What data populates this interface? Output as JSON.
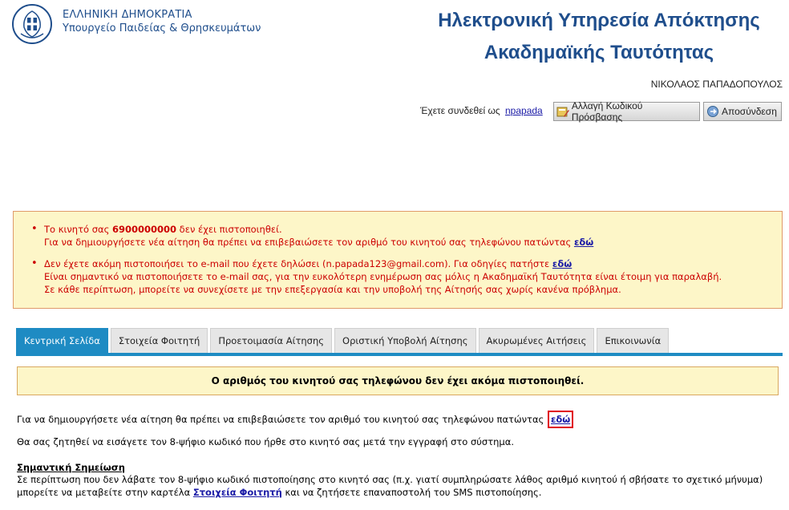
{
  "header": {
    "gov_line1": "ΕΛΛΗΝΙΚΗ ΔΗΜΟΚΡΑΤΙΑ",
    "gov_line2": "Υπουργείο Παιδείας & Θρησκευμάτων",
    "title_line1": "Ηλεκτρονική Υπηρεσία Απόκτησης",
    "title_line2": "Ακαδημαϊκής Ταυτότητας",
    "user_name": "ΝΙΚΟΛΑΟΣ ΠΑΠΑΔΟΠΟΥΛΟΣ",
    "logged_in_text": "Έχετε συνδεθεί ως",
    "username": "npapada",
    "change_password_label": "Αλλαγή Κωδικού Πρόσβασης",
    "logout_label": "Αποσύνδεση"
  },
  "warnings": {
    "w1_pre": "Το κινητό σας ",
    "w1_number": "6900000000",
    "w1_post": " δεν έχει πιστοποιηθεί.",
    "w1_line2": "Για να δημιουργήσετε νέα αίτηση θα πρέπει να επιβεβαιώσετε τον αριθμό του κινητού σας τηλεφώνου πατώντας",
    "w1_link": "εδώ",
    "w2_line1": "Δεν έχετε ακόμη πιστοποιήσει το e-mail που έχετε δηλώσει (n.papada123@gmail.com). Για οδηγίες πατήστε",
    "w2_link": "εδώ",
    "w2_line2": "Είναι σημαντικό να πιστοποιήσετε το e-mail σας, για την ευκολότερη ενημέρωση σας μόλις η Ακαδημαϊκή Ταυτότητα είναι έτοιμη για παραλαβή.",
    "w2_line3": "Σε κάθε περίπτωση, μπορείτε να συνεχίσετε με την επεξεργασία και την υποβολή της Αίτησής σας χωρίς κανένα πρόβλημα."
  },
  "tabs": [
    "Κεντρική Σελίδα",
    "Στοιχεία Φοιτητή",
    "Προετοιμασία Αίτησης",
    "Οριστική Υποβολή Αίτησης",
    "Ακυρωμένες Αιτήσεις",
    "Επικοινωνία"
  ],
  "main": {
    "notice": "Ο αριθμός του κινητού σας τηλεφώνου δεν έχει ακόμα πιστοποιηθεί.",
    "p1_text": "Για να δημιουργήσετε νέα αίτηση θα πρέπει να επιβεβαιώσετε τον αριθμό του κινητού σας τηλεφώνου πατώντας",
    "p1_link": "εδώ",
    "p2_text": "Θα σας ζητηθεί να εισάγετε τον 8-ψήφιο κωδικό που ήρθε στο κινητό σας μετά την εγγραφή στο σύστημα.",
    "note_title": "Σημαντική Σημείωση",
    "p3_pre": "Σε περίπτωση που δεν λάβατε τον 8-ψήφιο κωδικό πιστοποίησης στο κινητό σας (π.χ. γιατί συμπληρώσατε λάθος αριθμό κινητού ή σβήσατε το σχετικό μήνυμα) μπορείτε να μεταβείτε στην καρτέλα",
    "p3_link": "Στοιχεία Φοιτητή",
    "p3_post": "και να ζητήσετε επαναποστολή του SMS πιστοποίησης."
  },
  "colors": {
    "brand_blue": "#1f4e8c",
    "tab_active": "#1e8bc3",
    "warning_red": "#cc0000",
    "warning_bg": "#fdf6c8",
    "highlight_border": "#e0001b"
  }
}
